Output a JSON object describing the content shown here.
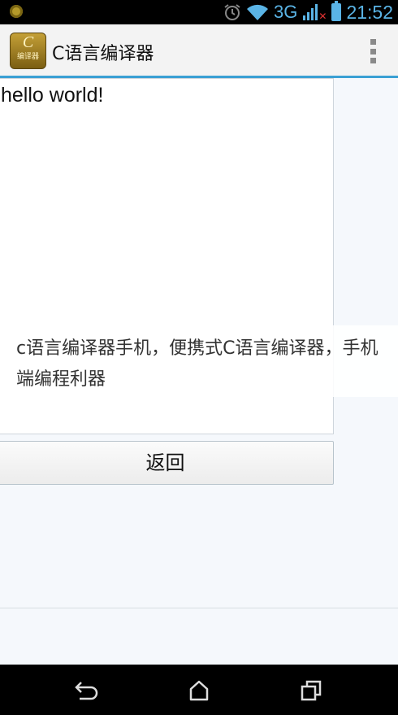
{
  "status_bar": {
    "network": "3G",
    "time": "21:52",
    "icons": [
      "notification-icon",
      "alarm-icon",
      "wifi-icon",
      "signal-icon",
      "battery-icon"
    ]
  },
  "action_bar": {
    "app_title": "C语言编译器",
    "app_icon_text_big": "C",
    "app_icon_text_small": "编译器"
  },
  "output": {
    "text": "hello world!"
  },
  "watermark": {
    "text": "c语言编译器手机，便携式C语言编译器，手机端编程利器"
  },
  "buttons": {
    "back_label": "返回"
  },
  "nav_bar": {
    "icons": [
      "back-icon",
      "home-icon",
      "recent-apps-icon"
    ]
  },
  "colors": {
    "accent": "#3aa0d4",
    "status_icons": "#5ab4e6"
  }
}
